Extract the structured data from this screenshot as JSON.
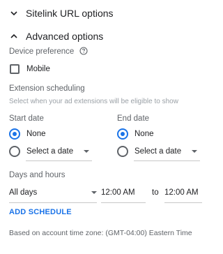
{
  "sitelink_section": {
    "title": "Sitelink URL options",
    "icon": "chevron-down-icon"
  },
  "advanced_section": {
    "title": "Advanced options",
    "icon": "chevron-up-icon"
  },
  "device": {
    "label": "Device preference",
    "help_icon": "help-circle-icon",
    "mobile_label": "Mobile",
    "mobile_checked": false
  },
  "scheduling": {
    "label": "Extension scheduling",
    "hint": "Select when your ad extensions will be eligible to show"
  },
  "start_date": {
    "label": "Start date",
    "options": [
      "None",
      "Select a date"
    ],
    "selected": "None"
  },
  "end_date": {
    "label": "End date",
    "options": [
      "None",
      "Select a date"
    ],
    "selected": "None"
  },
  "days_hours": {
    "label": "Days and hours",
    "days_value": "All days",
    "start_time": "12:00 AM",
    "to_label": "to",
    "end_time": "12:00 AM"
  },
  "add_schedule_label": "ADD SCHEDULE",
  "timezone_note": "Based on account time zone: (GMT-04:00) Eastern Time",
  "colors": {
    "accent": "#1a73e8",
    "text": "#202124",
    "muted": "#5f6368"
  }
}
